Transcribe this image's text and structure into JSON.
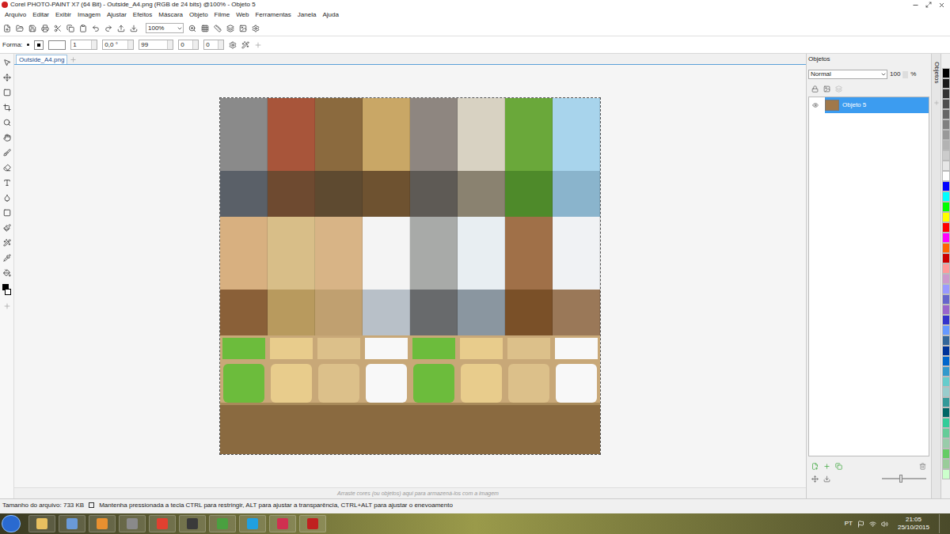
{
  "window": {
    "title": "Corel PHOTO-PAINT X7 (64 Bit) - Outside_A4.png (RGB de 24 bits) @100% - Objeto 5"
  },
  "menu": [
    "Arquivo",
    "Editar",
    "Exibir",
    "Imagem",
    "Ajustar",
    "Efeitos",
    "Máscara",
    "Objeto",
    "Filme",
    "Web",
    "Ferramentas",
    "Janela",
    "Ajuda"
  ],
  "toolbar": {
    "zoom": "100%"
  },
  "property_bar": {
    "label": "Forma:",
    "fields": [
      "1",
      "0,0 °",
      "99",
      "0",
      "0"
    ]
  },
  "document_tab": {
    "label": "Outside_A4.png",
    "selected": true
  },
  "color_well_hint": "Arraste cores (ou objetos) aqui para armazená-los com a imagem",
  "objects_docker": {
    "title": "Objetos",
    "blend_mode": "Normal",
    "opacity": "100",
    "opacity_unit": "%",
    "side_tab": "Objetos",
    "slider": {
      "level": 0.4
    },
    "objects": [
      {
        "name": "Objeto 5",
        "visible": true,
        "selected": true
      }
    ]
  },
  "palette": [
    {
      "color": "#000000"
    },
    {
      "color": "#1a1a1a"
    },
    {
      "color": "#333333"
    },
    {
      "color": "#4d4d4d"
    },
    {
      "color": "#666666"
    },
    {
      "color": "#808080"
    },
    {
      "color": "#999999"
    },
    {
      "color": "#b3b3b3"
    },
    {
      "color": "#cccccc"
    },
    {
      "color": "#e6e6e6"
    },
    {
      "color": "#ffffff"
    },
    {
      "color": "#0000ff"
    },
    {
      "color": "#00ffff"
    },
    {
      "color": "#00ff00"
    },
    {
      "color": "#ffff00"
    },
    {
      "color": "#ff0000"
    },
    {
      "color": "#ff00ff"
    },
    {
      "color": "#ff6600"
    },
    {
      "color": "#cc0000"
    },
    {
      "color": "#ff9999"
    },
    {
      "color": "#cc99cc"
    },
    {
      "color": "#9999ff"
    },
    {
      "color": "#6666cc"
    },
    {
      "color": "#9966cc"
    },
    {
      "color": "#3333cc"
    },
    {
      "color": "#6699ff"
    },
    {
      "color": "#336699"
    },
    {
      "color": "#003399"
    },
    {
      "color": "#0066cc"
    },
    {
      "color": "#3399cc"
    },
    {
      "color": "#66cccc"
    },
    {
      "color": "#99cccc"
    },
    {
      "color": "#339999"
    },
    {
      "color": "#006666"
    },
    {
      "color": "#33cc99"
    },
    {
      "color": "#66cc99"
    },
    {
      "color": "#99ccaa"
    },
    {
      "color": "#66cc66"
    },
    {
      "color": "#99cc99"
    },
    {
      "color": "#ccffcc"
    }
  ],
  "status_bar": {
    "file_size": "Tamanho do arquivo: 733 KB",
    "hint": "Mantenha pressionada a tecla CTRL para restringir, ALT para ajustar a transparência, CTRL+ALT para ajustar o enevoamento"
  },
  "taskbar": {
    "apps": [
      {
        "color": "#e8c060"
      },
      {
        "color": "#6a9ad8"
      },
      {
        "color": "#e89030"
      },
      {
        "color": "#8a8a8a"
      },
      {
        "color": "#e04030"
      },
      {
        "color": "#3a3a3a"
      },
      {
        "color": "#4aa040"
      },
      {
        "color": "#20a0e0"
      },
      {
        "color": "#d03050"
      },
      {
        "color": "#c02020"
      }
    ],
    "language": "PT",
    "time": "21:05",
    "date": "25/10/2015"
  }
}
